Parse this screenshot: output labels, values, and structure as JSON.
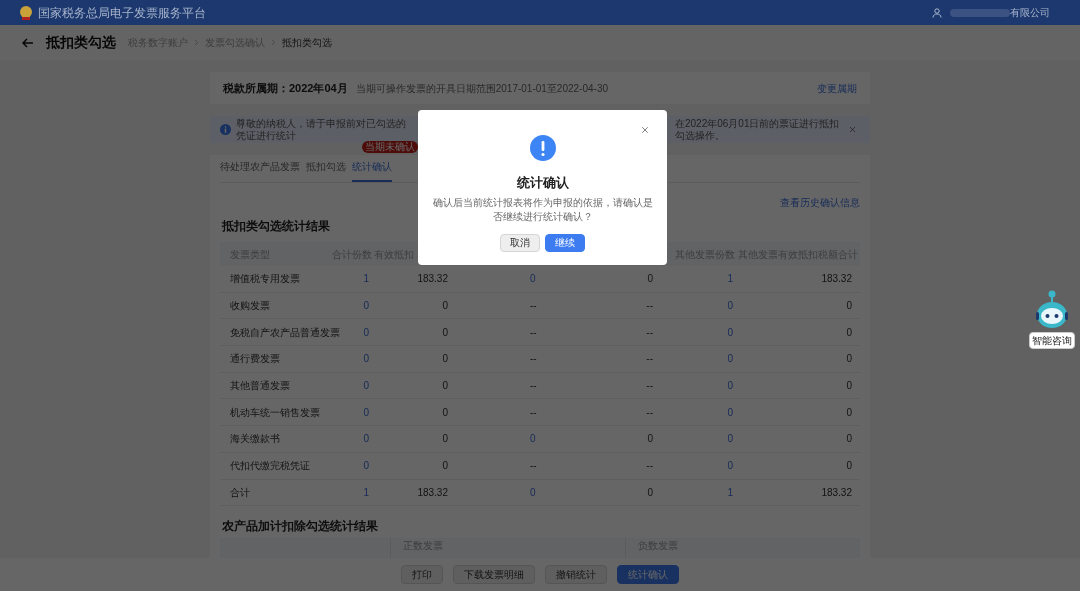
{
  "header": {
    "title": "国家税务总局电子发票服务平台",
    "user": "有限公司"
  },
  "breadcrumb": {
    "title": "抵扣类勾选",
    "items": [
      "税务数字账户",
      "发票勾选确认",
      "抵扣类勾选"
    ]
  },
  "period": {
    "label": "税款所属期：",
    "value": "2022年04月",
    "hint": "当期可操作发票的开具日期范围2017-01-01至2022-04-30",
    "link": "变更属期"
  },
  "notice": {
    "left": "尊敬的纳税人，请于申报前对已勾选的凭证进行统计",
    "right": "在2022年06月01日前的票证进行抵扣勾选操作。"
  },
  "tabs": [
    {
      "label": "待处理农产品发票",
      "selected": false
    },
    {
      "label": "抵扣勾选",
      "selected": false
    },
    {
      "label": "统计确认",
      "selected": true,
      "badge": "当期未确认"
    }
  ],
  "history_link": "查看历史确认信息",
  "section_title": "抵扣类勾选统计结果",
  "table": {
    "columns": [
      "发票类型",
      "合计份数",
      "有效抵扣",
      "其他发票份数",
      "其他发票有效抵扣税额合计"
    ],
    "rows": [
      {
        "type": "增值税专用发票",
        "count": "1",
        "amount": "183.32",
        "column_4": "0",
        "column_4_link": true,
        "column_5": "0",
        "other_count": "1",
        "other_amount": "183.32"
      },
      {
        "type": "收购发票",
        "count": "0",
        "amount": "0",
        "column_4": "--",
        "column_4_link": false,
        "column_5": "--",
        "other_count": "0",
        "other_amount": "0"
      },
      {
        "type": "免税自产农产品普通发票",
        "count": "0",
        "amount": "0",
        "column_4": "--",
        "column_4_link": false,
        "column_5": "--",
        "other_count": "0",
        "other_amount": "0"
      },
      {
        "type": "通行费发票",
        "count": "0",
        "amount": "0",
        "column_4": "--",
        "column_4_link": false,
        "column_5": "--",
        "other_count": "0",
        "other_amount": "0"
      },
      {
        "type": "其他普通发票",
        "count": "0",
        "amount": "0",
        "column_4": "--",
        "column_4_link": false,
        "column_5": "--",
        "other_count": "0",
        "other_amount": "0"
      },
      {
        "type": "机动车统一销售发票",
        "count": "0",
        "amount": "0",
        "column_4": "--",
        "column_4_link": false,
        "column_5": "--",
        "other_count": "0",
        "other_amount": "0"
      },
      {
        "type": "海关缴款书",
        "count": "0",
        "amount": "0",
        "column_4": "0",
        "column_4_link": true,
        "column_5": "0",
        "other_count": "0",
        "other_amount": "0"
      },
      {
        "type": "代扣代缴完税凭证",
        "count": "0",
        "amount": "0",
        "column_4": "--",
        "column_4_link": false,
        "column_5": "--",
        "other_count": "0",
        "other_amount": "0"
      },
      {
        "type": "合计",
        "count": "1",
        "amount": "183.32",
        "column_4": "0",
        "column_4_link": true,
        "column_5": "0",
        "other_count": "1",
        "other_amount": "183.32"
      }
    ]
  },
  "section2": {
    "title": "农产品加计扣除勾选统计结果",
    "columns": [
      "正数发票",
      "负数发票"
    ]
  },
  "footer_buttons": [
    {
      "label": "打印",
      "kind": "default"
    },
    {
      "label": "下载发票明细",
      "kind": "default"
    },
    {
      "label": "撤销统计",
      "kind": "default"
    },
    {
      "label": "统计确认",
      "kind": "primary"
    }
  ],
  "assistant": {
    "label": "智能咨询"
  },
  "dialog": {
    "title": "统计确认",
    "message": "确认后当前统计报表将作为申报的依据，请确认是否继续进行统计确认？",
    "buttons": [
      {
        "label": "取消",
        "kind": "default"
      },
      {
        "label": "继续",
        "kind": "primary"
      }
    ]
  }
}
